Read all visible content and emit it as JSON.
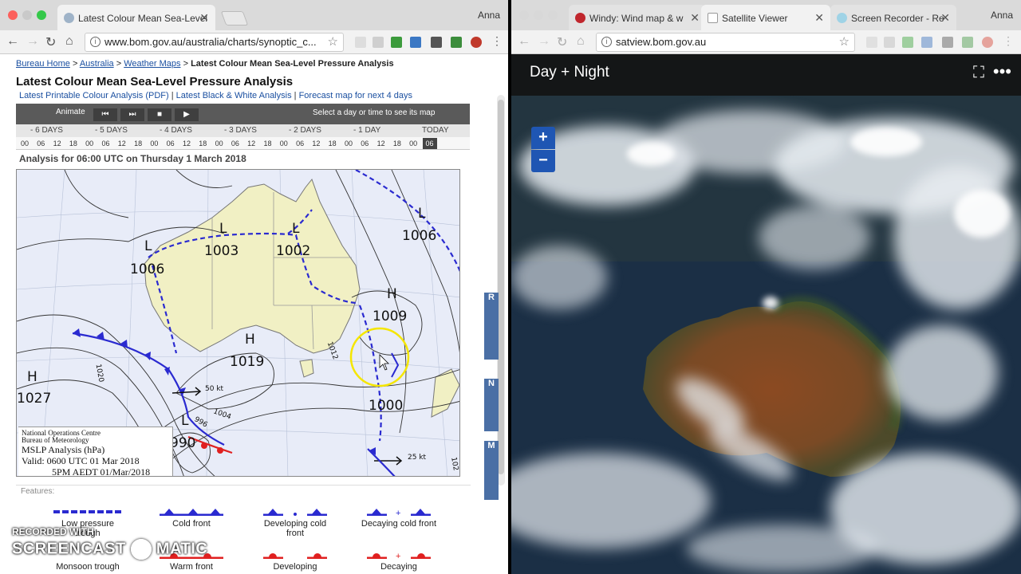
{
  "left": {
    "tab_title": "Latest Colour Mean Sea-Level",
    "user": "Anna",
    "url": "www.bom.gov.au/australia/charts/synoptic_c...",
    "breadcrumb": {
      "home": "Bureau Home",
      "sep1": ">",
      "australia": "Australia",
      "sep2": ">",
      "weather_maps": "Weather Maps",
      "sep3": ">",
      "current": "Latest Colour Mean Sea-Level Pressure Analysis"
    },
    "page_title": "Latest Colour Mean Sea-Level Pressure Analysis",
    "links": {
      "printable": "Latest Printable Colour Analysis (PDF)",
      "sep1": "|",
      "bw": "Latest Black & White Analysis",
      "sep2": "|",
      "forecast": "Forecast map for next 4 days"
    },
    "animate_label": "Animate",
    "select_hint": "Select a day or time to see its map",
    "days": [
      "- 6 DAYS",
      "- 5 DAYS",
      "- 4 DAYS",
      "- 3 DAYS",
      "- 2 DAYS",
      "- 1 DAY",
      "TODAY"
    ],
    "hours": [
      "00",
      "06",
      "12",
      "18",
      "00",
      "06",
      "12",
      "18",
      "00",
      "06",
      "12",
      "18",
      "00",
      "06",
      "12",
      "18",
      "00",
      "06",
      "12",
      "18",
      "00",
      "06",
      "12",
      "18",
      "00",
      "06"
    ],
    "selected_hour_index": 25,
    "analysis_title": "Analysis for 06:00 UTC on Thursday 1 March 2018",
    "map_labels": {
      "l1": "L",
      "p1006w": "1006",
      "l2": "L",
      "p1003": "1003",
      "l3": "L",
      "p1002": "1002",
      "l4": "L",
      "p1006e": "1006",
      "h1": "H",
      "p1009": "1009",
      "h2": "H",
      "p1019": "1019",
      "h3": "H",
      "p1027": "1027",
      "l5": "L",
      "p990": "990",
      "p1000": "1000",
      "wind50": "50 kt",
      "wind25": "25 kt",
      "iso1020": "1020",
      "iso1004": "1004",
      "iso996": "996",
      "iso1012": "1012",
      "iso102": "102"
    },
    "map_legend": {
      "org1": "National Operations Centre",
      "org2": "Bureau of Meteorology",
      "line1": "MSLP Analysis (hPa)",
      "line2": "Valid: 0600 UTC 01 Mar 2018",
      "line3": "5PM AEDT 01/Mar/2018"
    },
    "side_tabs": [
      "R",
      "N",
      "M"
    ],
    "features_title": "Features:",
    "features": [
      {
        "label": "Low pressure trough"
      },
      {
        "label": "Cold front"
      },
      {
        "label": "Developing cold front"
      },
      {
        "label": "Decaying cold front"
      },
      {
        "label": "Monsoon trough"
      },
      {
        "label": "Warm front"
      },
      {
        "label": "Developing"
      },
      {
        "label": "Decaying"
      }
    ]
  },
  "right": {
    "tabs": [
      {
        "title": "Windy: Wind map & w"
      },
      {
        "title": "Satellite Viewer"
      },
      {
        "title": "Screen Recorder - Re"
      }
    ],
    "user": "Anna",
    "url": "satview.bom.gov.au",
    "viewer_title": "Day + Night",
    "zoom_in": "+",
    "zoom_out": "−"
  },
  "watermark": {
    "line1": "RECORDED WITH",
    "line2": "SCREENCAST",
    "line3": "MATIC"
  },
  "colors": {
    "link": "#1a4fa0",
    "front_blue": "#2a2ad0",
    "front_red": "#e02020",
    "land": "#f1f0c4",
    "sea": "#e8ecf8",
    "highlight": "#f5e600"
  }
}
